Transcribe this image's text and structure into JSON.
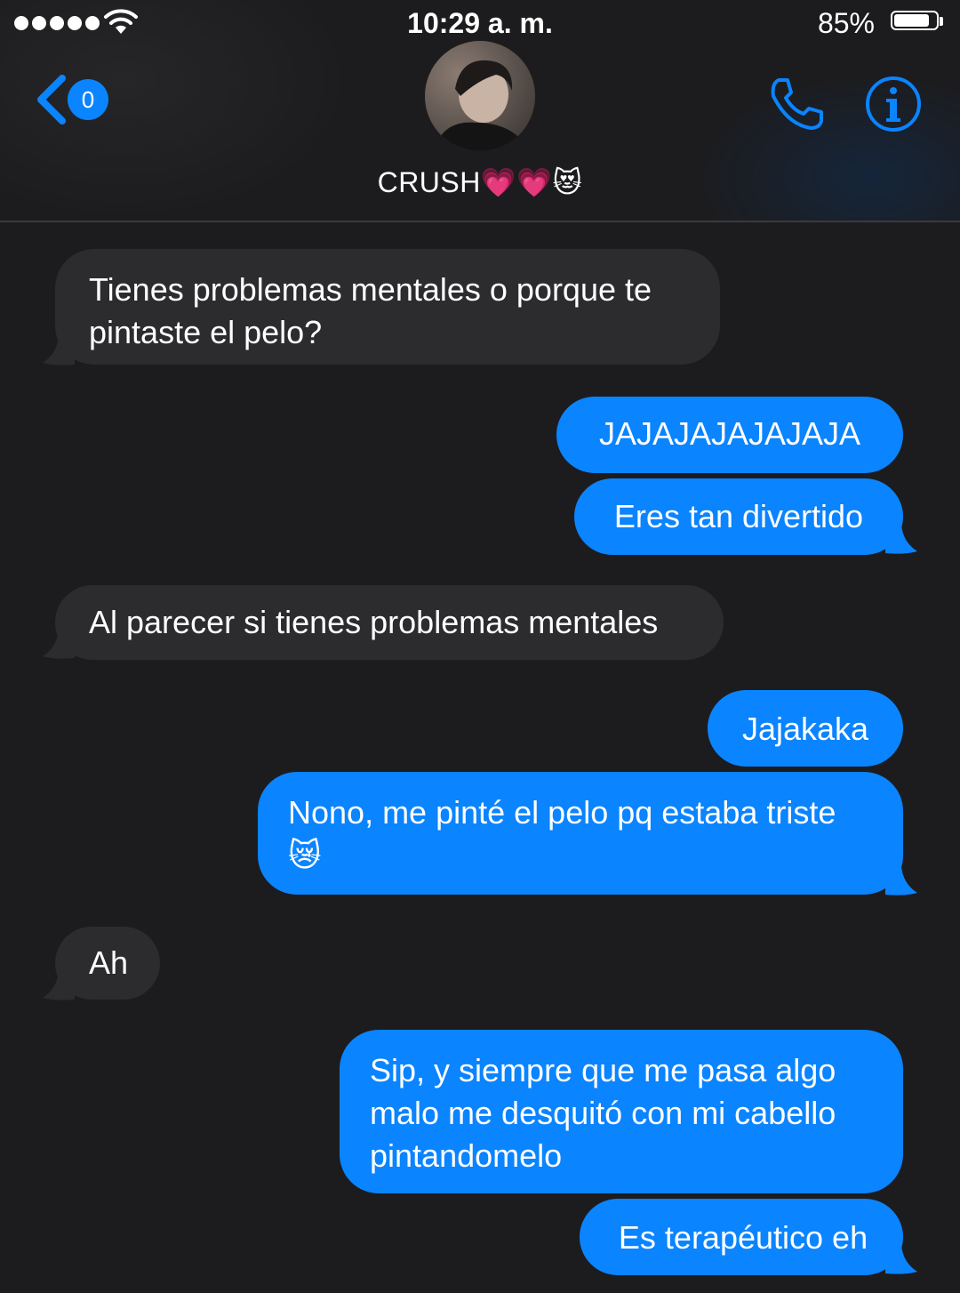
{
  "status_bar": {
    "time": "10:29 a. m.",
    "battery_percent": "85%",
    "battery_level": 0.85
  },
  "header": {
    "back_badge": "0",
    "contact_name": "CRUSH💗💗😻"
  },
  "messages": [
    {
      "direction": "incoming",
      "text": "Tienes problemas mentales o porque te pintaste el pelo?"
    },
    {
      "direction": "outgoing",
      "text": "JAJAJAJAJAJAJA"
    },
    {
      "direction": "outgoing",
      "text": "Eres tan divertido"
    },
    {
      "direction": "incoming",
      "text": "Al parecer si tienes problemas mentales"
    },
    {
      "direction": "outgoing",
      "text": "Jajakaka"
    },
    {
      "direction": "outgoing",
      "text": "Nono, me pinté el pelo pq estaba triste 😿"
    },
    {
      "direction": "incoming",
      "text": "Ah"
    },
    {
      "direction": "outgoing",
      "text": "Sip, y siempre que me pasa algo malo me desquitó con mi cabello pintandomelo"
    },
    {
      "direction": "outgoing",
      "text": "Es terapéutico eh"
    }
  ],
  "icons": {
    "back": "chevron-left-icon",
    "call": "phone-icon",
    "info": "info-icon",
    "signal": "signal-dots-icon",
    "wifi": "wifi-icon",
    "battery": "battery-icon"
  },
  "colors": {
    "background": "#1c1c1e",
    "incoming_bubble": "#2c2c2e",
    "outgoing_bubble": "#0a84ff",
    "accent": "#0a84ff"
  }
}
